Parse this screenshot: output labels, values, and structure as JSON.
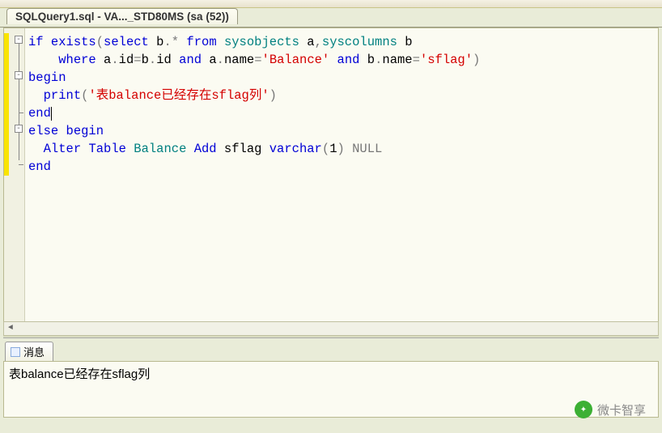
{
  "tab": {
    "title": "SQLQuery1.sql - VA..._STD80MS (sa (52))"
  },
  "code": {
    "line1": {
      "if": "if",
      "exists": "exists",
      "select": "select",
      "bstar": "b",
      "dot1": ".",
      "star": "*",
      "from": "from",
      "sysobjects": "sysobjects",
      "a": "a",
      "comma": ",",
      "syscolumns": "syscolumns",
      "b": "b"
    },
    "line2": {
      "where": "where",
      "a1": "a",
      "dot1": ".",
      "id1": "id",
      "eq1": "=",
      "b1": "b",
      "dot2": ".",
      "id2": "id",
      "and1": "and",
      "a2": "a",
      "dot3": ".",
      "name1": "name",
      "eq2": "=",
      "str1": "'Balance'",
      "and2": "and",
      "b2": "b",
      "dot4": ".",
      "name2": "name",
      "eq3": "=",
      "str2": "'sflag'",
      "rp": ")"
    },
    "line3": {
      "begin": "begin"
    },
    "line4": {
      "print": "print",
      "lp": "(",
      "str": "'表balance已经存在sflag列'",
      "rp": ")"
    },
    "line5": {
      "end": "end"
    },
    "line6": {
      "else": "else",
      "begin": "begin"
    },
    "line7": {
      "alter": "Alter",
      "table": "Table",
      "balance": "Balance",
      "add": "Add",
      "sflag": "sflag",
      "varchar": "varchar",
      "lp": "(",
      "one": "1",
      "rp": ")",
      "null": "NULL"
    },
    "line8": {
      "end": "end"
    }
  },
  "output": {
    "tab_label": "消息",
    "message": "表balance已经存在sflag列"
  },
  "watermark": {
    "text": "微卡智享"
  }
}
